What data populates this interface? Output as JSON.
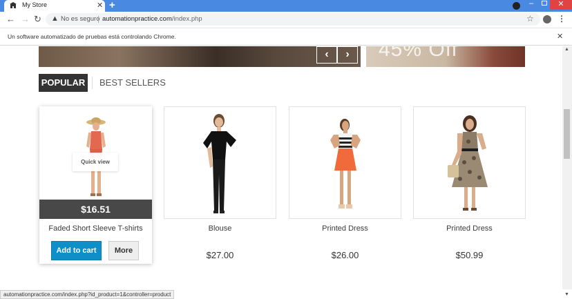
{
  "browser": {
    "tab_title": "My Store",
    "tab_close": "✕",
    "new_tab": "+",
    "security_label": "No es seguro",
    "url_domain": "automationpractice.com",
    "url_path": "/index.php"
  },
  "infobar": {
    "message": "Un software automatizado de pruebas está controlando Chrome.",
    "close": "✕"
  },
  "page": {
    "tabs": [
      {
        "label": "POPULAR",
        "active": true
      },
      {
        "label": "BEST SELLERS",
        "active": false
      }
    ],
    "products": [
      {
        "name": "Faded Short Sleeve T-shirts",
        "price": "$16.51",
        "hovered": true,
        "quick_view": "Quick view",
        "add_to_cart": "Add to cart",
        "more": "More"
      },
      {
        "name": "Blouse",
        "price": "$27.00",
        "hovered": false
      },
      {
        "name": "Printed Dress",
        "price": "$26.00",
        "hovered": false
      },
      {
        "name": "Printed Dress",
        "price": "$50.99",
        "hovered": false
      }
    ]
  },
  "status_bar": {
    "url": "automationpractice.com/index.php?id_product=1&controller=product"
  },
  "colors": {
    "chrome_blue": "#4a89e2",
    "cart_button": "#0f8fc8",
    "price_band": "#484848"
  },
  "icons": [
    "store-favicon-icon",
    "back-arrow-icon",
    "forward-arrow-icon",
    "reload-icon",
    "warning-icon",
    "star-icon",
    "account-icon",
    "menu-icon",
    "chevron-left-icon",
    "chevron-right-icon"
  ]
}
